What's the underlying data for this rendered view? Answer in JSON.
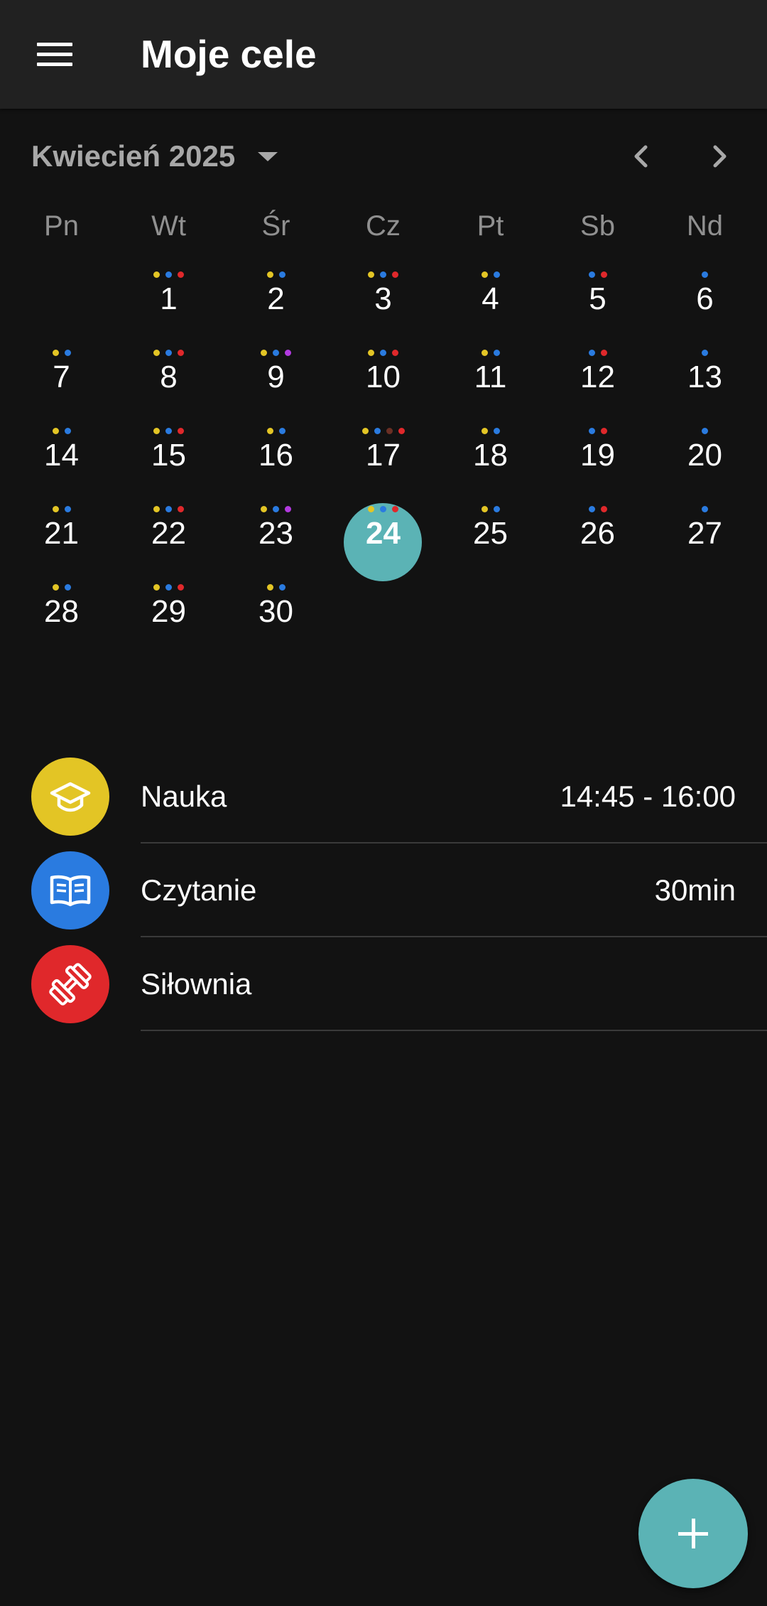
{
  "app": {
    "title": "Moje cele"
  },
  "calendar": {
    "month_label": "Kwiecień 2025",
    "weekdays": [
      "Pn",
      "Wt",
      "Śr",
      "Cz",
      "Pt",
      "Sb",
      "Nd"
    ],
    "first_weekday_index": 1,
    "selected_day": 24,
    "dot_colors": {
      "y": "#e3c525",
      "b": "#2a7be0",
      "r": "#e0282b",
      "p": "#b23ae0",
      "d": "#6b2f24"
    },
    "days": [
      {
        "label": "1",
        "dots": [
          "y",
          "b",
          "r"
        ]
      },
      {
        "label": "2",
        "dots": [
          "y",
          "b"
        ]
      },
      {
        "label": "3",
        "dots": [
          "y",
          "b",
          "r"
        ]
      },
      {
        "label": "4",
        "dots": [
          "y",
          "b"
        ]
      },
      {
        "label": "5",
        "dots": [
          "b",
          "r"
        ]
      },
      {
        "label": "6",
        "dots": [
          "b"
        ]
      },
      {
        "label": "7",
        "dots": [
          "y",
          "b"
        ]
      },
      {
        "label": "8",
        "dots": [
          "y",
          "b",
          "r"
        ]
      },
      {
        "label": "9",
        "dots": [
          "y",
          "b",
          "p"
        ]
      },
      {
        "label": "10",
        "dots": [
          "y",
          "b",
          "r"
        ]
      },
      {
        "label": "11",
        "dots": [
          "y",
          "b"
        ]
      },
      {
        "label": "12",
        "dots": [
          "b",
          "r"
        ]
      },
      {
        "label": "13",
        "dots": [
          "b"
        ]
      },
      {
        "label": "14",
        "dots": [
          "y",
          "b"
        ]
      },
      {
        "label": "15",
        "dots": [
          "y",
          "b",
          "r"
        ]
      },
      {
        "label": "16",
        "dots": [
          "y",
          "b"
        ]
      },
      {
        "label": "17",
        "dots": [
          "y",
          "b",
          "d",
          "r"
        ]
      },
      {
        "label": "18",
        "dots": [
          "y",
          "b"
        ]
      },
      {
        "label": "19",
        "dots": [
          "b",
          "r"
        ]
      },
      {
        "label": "20",
        "dots": [
          "b"
        ]
      },
      {
        "label": "21",
        "dots": [
          "y",
          "b"
        ]
      },
      {
        "label": "22",
        "dots": [
          "y",
          "b",
          "r"
        ]
      },
      {
        "label": "23",
        "dots": [
          "y",
          "b",
          "p"
        ]
      },
      {
        "label": "24",
        "dots": [
          "y",
          "b",
          "r"
        ]
      },
      {
        "label": "25",
        "dots": [
          "y",
          "b"
        ]
      },
      {
        "label": "26",
        "dots": [
          "b",
          "r"
        ]
      },
      {
        "label": "27",
        "dots": [
          "b"
        ]
      },
      {
        "label": "28",
        "dots": [
          "y",
          "b"
        ]
      },
      {
        "label": "29",
        "dots": [
          "y",
          "b",
          "r"
        ]
      },
      {
        "label": "30",
        "dots": [
          "y",
          "b"
        ]
      }
    ]
  },
  "goals": [
    {
      "name": "Nauka",
      "time": "14:45 - 16:00",
      "icon": "graduation-cap-icon",
      "color": "#e3c525"
    },
    {
      "name": "Czytanie",
      "time": "30min",
      "icon": "open-book-icon",
      "color": "#2a7be0"
    },
    {
      "name": "Siłownia",
      "time": "",
      "icon": "dumbbell-icon",
      "color": "#e0282b"
    }
  ],
  "colors": {
    "accent": "#5bb3b5",
    "appbar": "#212121",
    "background": "#121212"
  }
}
